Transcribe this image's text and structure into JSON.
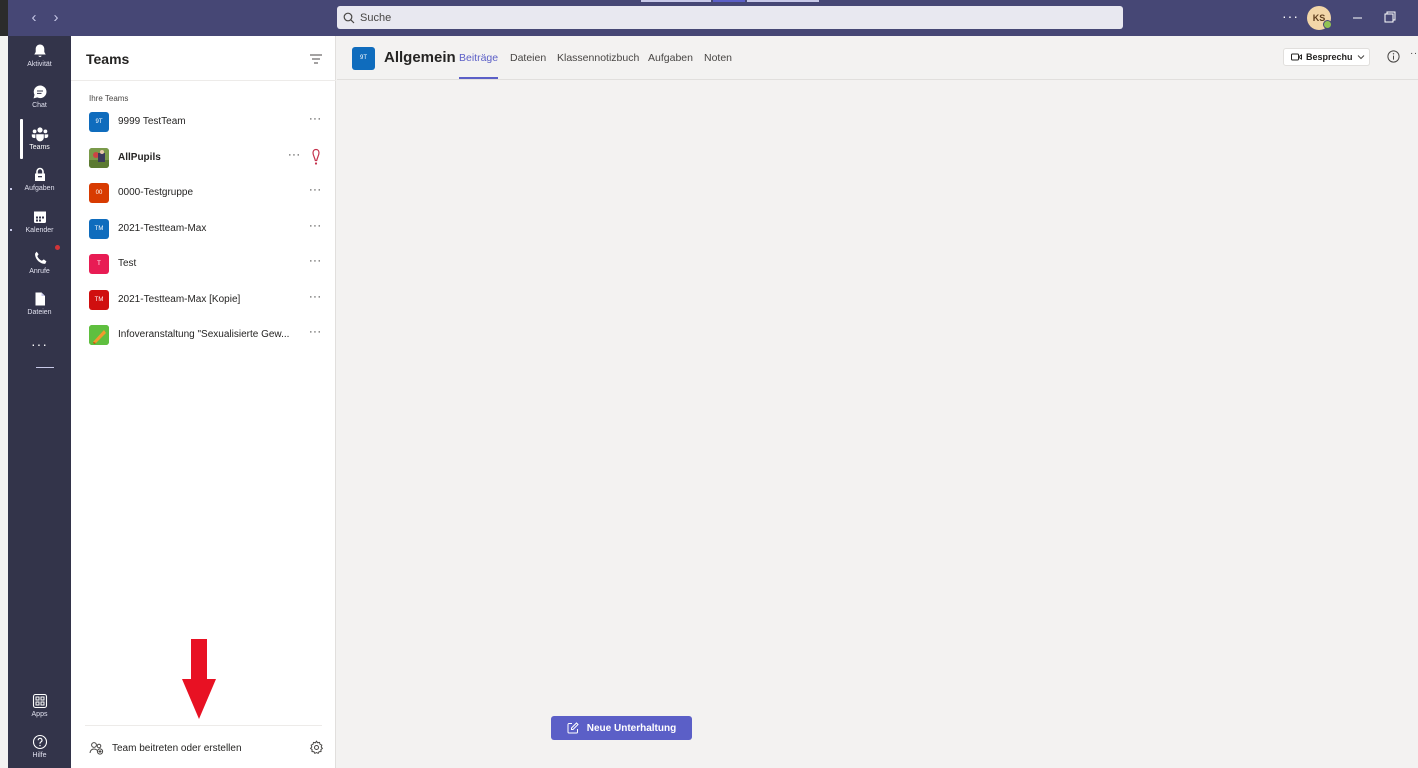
{
  "window": {
    "search_placeholder": "Suche",
    "avatar_initials": "KS",
    "more_label": "···"
  },
  "rail": {
    "items": [
      {
        "label": "Aktivität",
        "icon": "bell-icon"
      },
      {
        "label": "Chat",
        "icon": "chat-icon"
      },
      {
        "label": "Teams",
        "icon": "teams-icon",
        "active": true
      },
      {
        "label": "Aufgaben",
        "icon": "assignments-icon"
      },
      {
        "label": "Kalender",
        "icon": "calendar-icon"
      },
      {
        "label": "Anrufe",
        "icon": "phone-icon"
      },
      {
        "label": "Dateien",
        "icon": "file-icon"
      }
    ],
    "more_label": "···",
    "bottom": [
      {
        "label": "Apps",
        "icon": "apps-icon"
      },
      {
        "label": "Hilfe",
        "icon": "help-icon"
      }
    ]
  },
  "teams_pane": {
    "title": "Teams",
    "section_label": "Ihre Teams",
    "more_label": "···",
    "teams": [
      {
        "initials": "9T",
        "name": "9999 TestTeam",
        "color": "#0f6cbd"
      },
      {
        "initials": "",
        "name": "AllPupils",
        "color": "#6b8e3a",
        "bold": true
      },
      {
        "initials": "00",
        "name": "0000-Testgruppe",
        "color": "#d83b01"
      },
      {
        "initials": "TM",
        "name": "2021-Testteam-Max",
        "color": "#0f6cbd"
      },
      {
        "initials": "T",
        "name": "Test",
        "color": "#e81c54"
      },
      {
        "initials": "TM",
        "name": "2021-Testteam-Max [Kopie]",
        "color": "#d00f0f"
      },
      {
        "initials": "",
        "name": "Infoveranstaltung \"Sexualisierte Gew...",
        "color": "#5fbf3f"
      }
    ],
    "join_label": "Team beitreten oder erstellen"
  },
  "channel": {
    "tile_initials": "9T",
    "title": "Allgemein",
    "tabs": [
      "Beiträge",
      "Dateien",
      "Klassennotizbuch",
      "Aufgaben",
      "Noten"
    ],
    "meeting_label": "Besprechung",
    "more_label": "···"
  },
  "new_conversation_label": "Neue Unterhaltung",
  "colors": {
    "titlebar": "#464775",
    "rail": "#33344a",
    "accent": "#5b5fc7",
    "arrow": "#e81123"
  }
}
